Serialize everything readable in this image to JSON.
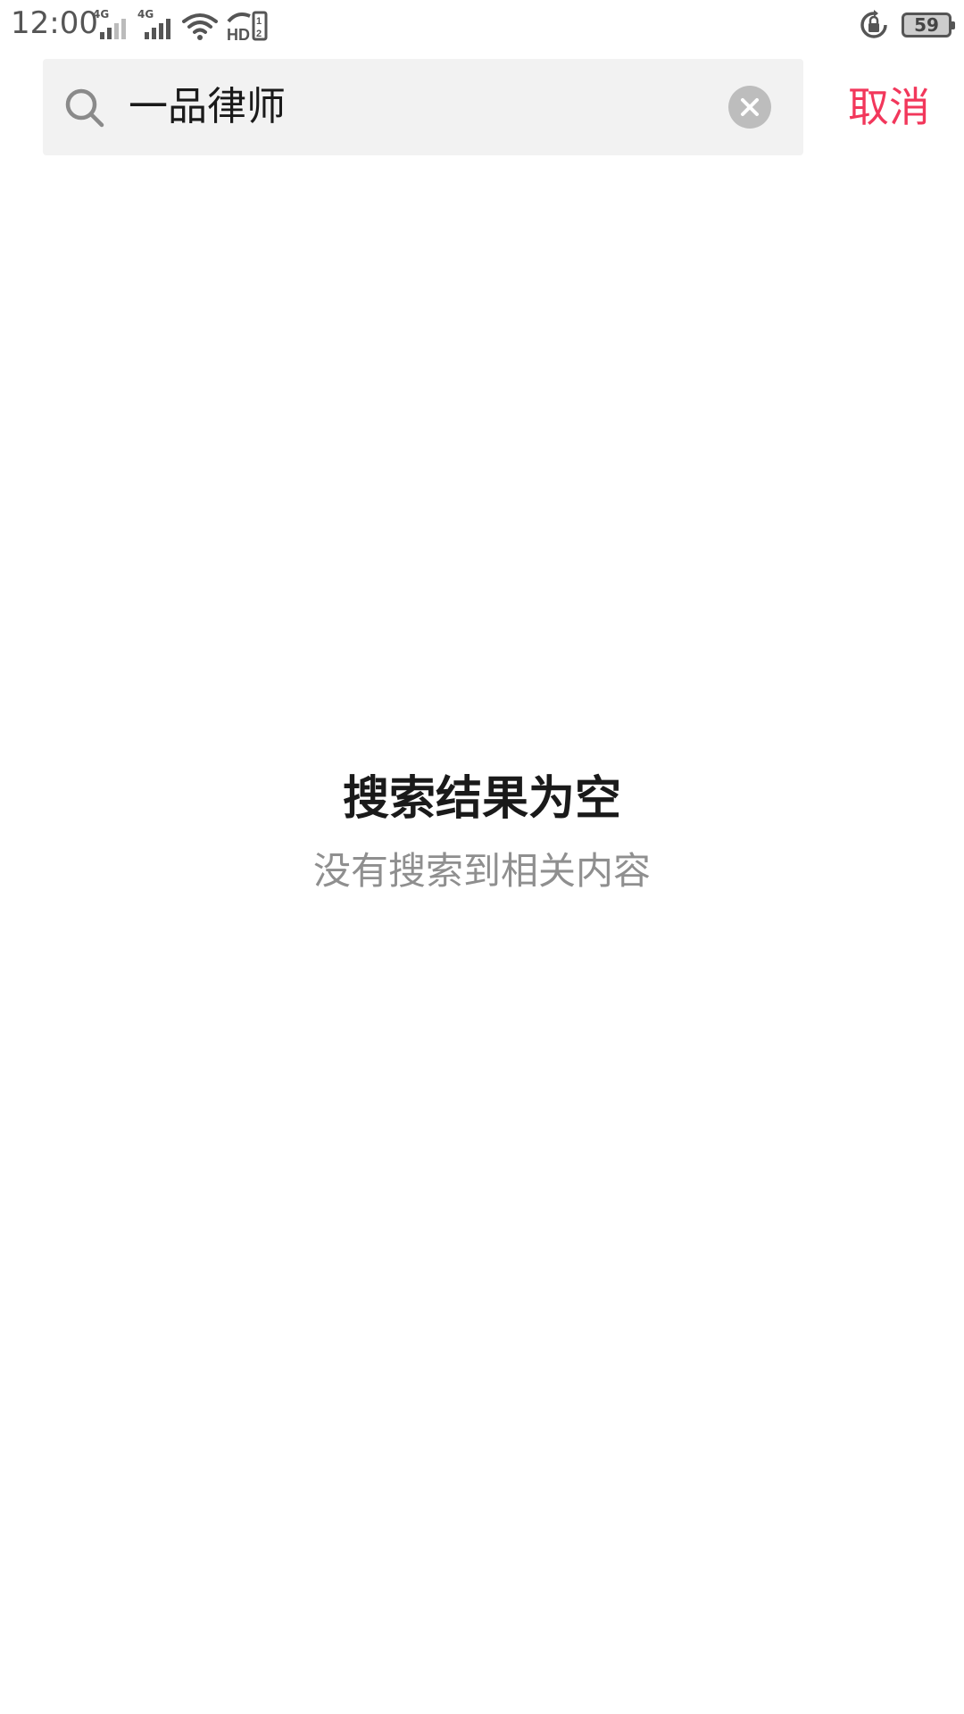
{
  "status_bar": {
    "time": "12:00",
    "signal_1": {
      "tag": "4G",
      "icon": "cellular-signal-icon"
    },
    "signal_2": {
      "tag": "4G",
      "icon": "cellular-signal-icon"
    },
    "wifi_icon": "wifi-icon",
    "hd_icon": "hd-voice-icon",
    "rotation_lock_icon": "rotation-lock-icon",
    "battery_level": "59"
  },
  "search": {
    "query": "一品律师",
    "search_icon": "search-icon",
    "clear_icon": "close-icon",
    "cancel_label": "取消"
  },
  "empty_state": {
    "title": "搜索结果为空",
    "subtitle": "没有搜索到相关内容"
  },
  "colors": {
    "accent": "#f2375b",
    "search_bg": "#f2f2f2",
    "title": "#1a1a1a",
    "subtitle": "#8f8f8f"
  }
}
